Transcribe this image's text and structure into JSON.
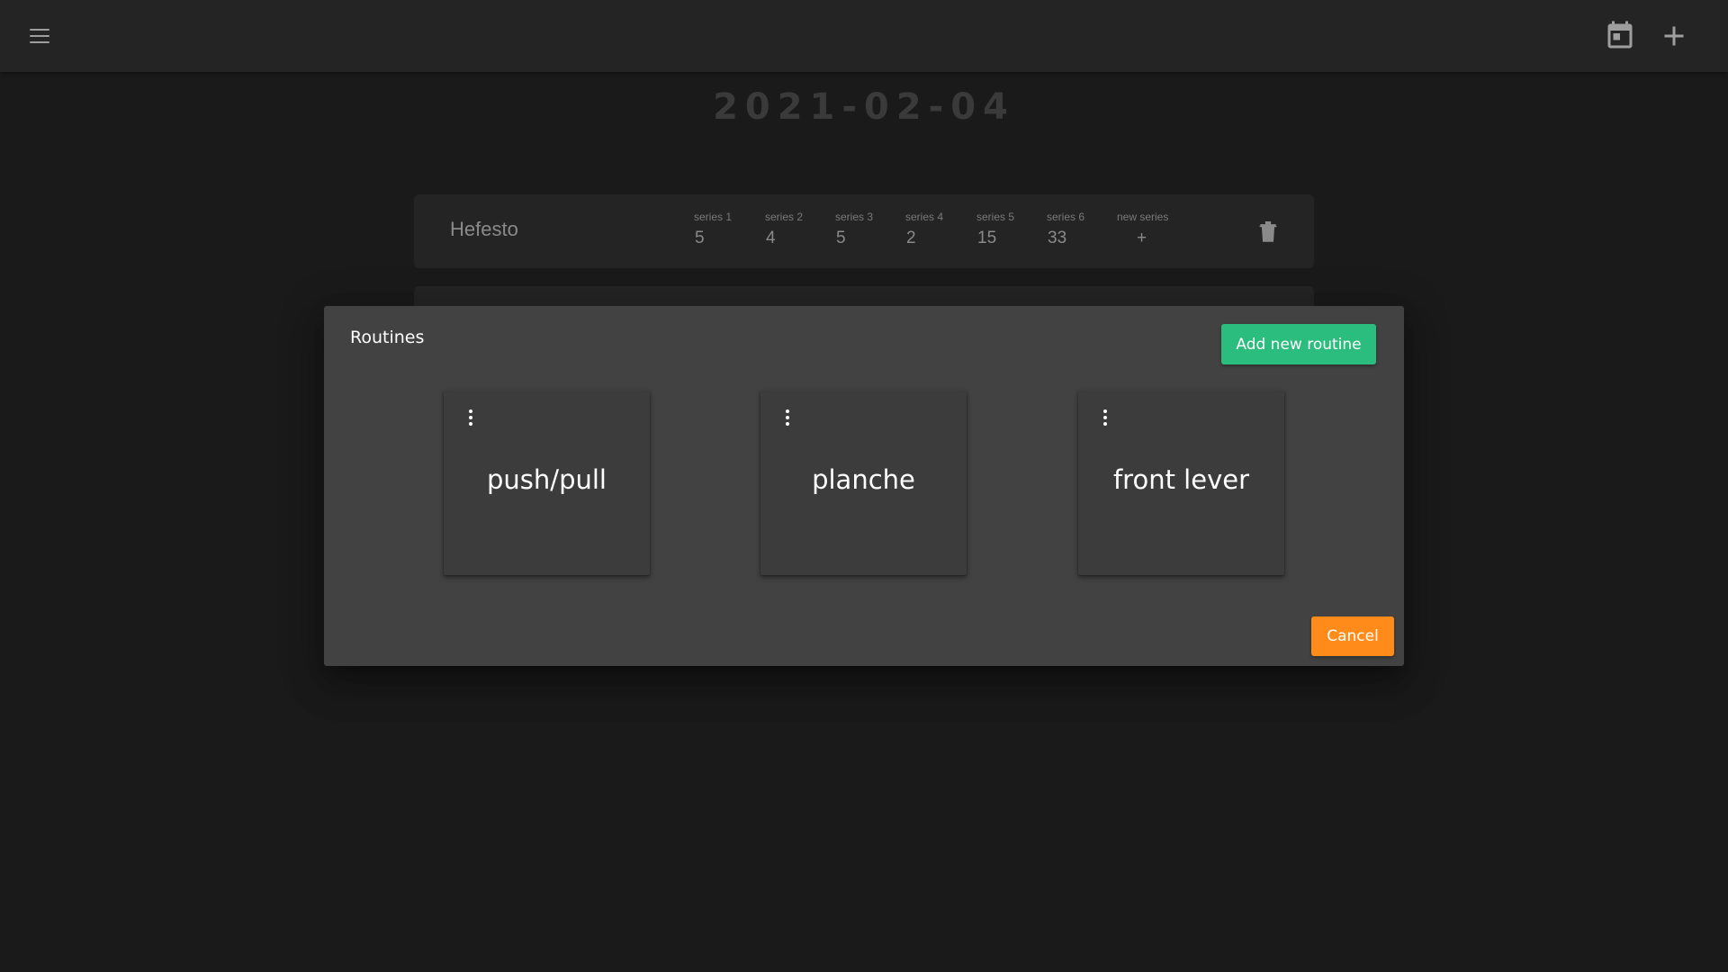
{
  "header": {
    "menu_icon": "menu-icon",
    "calendar_icon": "calendar-today-icon",
    "add_icon": "plus-icon"
  },
  "date": "2021-02-04",
  "exercise": {
    "name": "Hefesto",
    "series": [
      {
        "label": "series 1",
        "value": "5"
      },
      {
        "label": "series 2",
        "value": "4"
      },
      {
        "label": "series 3",
        "value": "5"
      },
      {
        "label": "series 4",
        "value": "2"
      },
      {
        "label": "series 5",
        "value": "15"
      },
      {
        "label": "series 6",
        "value": "33"
      }
    ],
    "new_series": {
      "label": "new series",
      "value": "+"
    },
    "delete_icon": "trash-icon"
  },
  "dialog": {
    "title": "Routines",
    "add_button": "Add new routine",
    "cancel_button": "Cancel",
    "routines": [
      {
        "name": "push/pull"
      },
      {
        "name": "planche"
      },
      {
        "name": "front lever"
      }
    ]
  },
  "colors": {
    "background": "#1a1a1a",
    "appbar": "#242424",
    "dialog": "#424242",
    "accent_green": "#2bbd7e",
    "accent_orange": "#ff8c1a"
  }
}
